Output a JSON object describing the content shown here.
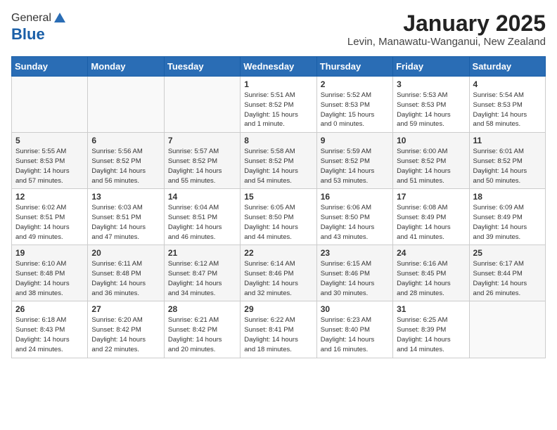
{
  "header": {
    "logo_general": "General",
    "logo_blue": "Blue",
    "month": "January 2025",
    "location": "Levin, Manawatu-Wanganui, New Zealand"
  },
  "weekdays": [
    "Sunday",
    "Monday",
    "Tuesday",
    "Wednesday",
    "Thursday",
    "Friday",
    "Saturday"
  ],
  "weeks": [
    [
      {
        "day": "",
        "info": ""
      },
      {
        "day": "",
        "info": ""
      },
      {
        "day": "",
        "info": ""
      },
      {
        "day": "1",
        "info": "Sunrise: 5:51 AM\nSunset: 8:52 PM\nDaylight: 15 hours\nand 1 minute."
      },
      {
        "day": "2",
        "info": "Sunrise: 5:52 AM\nSunset: 8:53 PM\nDaylight: 15 hours\nand 0 minutes."
      },
      {
        "day": "3",
        "info": "Sunrise: 5:53 AM\nSunset: 8:53 PM\nDaylight: 14 hours\nand 59 minutes."
      },
      {
        "day": "4",
        "info": "Sunrise: 5:54 AM\nSunset: 8:53 PM\nDaylight: 14 hours\nand 58 minutes."
      }
    ],
    [
      {
        "day": "5",
        "info": "Sunrise: 5:55 AM\nSunset: 8:53 PM\nDaylight: 14 hours\nand 57 minutes."
      },
      {
        "day": "6",
        "info": "Sunrise: 5:56 AM\nSunset: 8:52 PM\nDaylight: 14 hours\nand 56 minutes."
      },
      {
        "day": "7",
        "info": "Sunrise: 5:57 AM\nSunset: 8:52 PM\nDaylight: 14 hours\nand 55 minutes."
      },
      {
        "day": "8",
        "info": "Sunrise: 5:58 AM\nSunset: 8:52 PM\nDaylight: 14 hours\nand 54 minutes."
      },
      {
        "day": "9",
        "info": "Sunrise: 5:59 AM\nSunset: 8:52 PM\nDaylight: 14 hours\nand 53 minutes."
      },
      {
        "day": "10",
        "info": "Sunrise: 6:00 AM\nSunset: 8:52 PM\nDaylight: 14 hours\nand 51 minutes."
      },
      {
        "day": "11",
        "info": "Sunrise: 6:01 AM\nSunset: 8:52 PM\nDaylight: 14 hours\nand 50 minutes."
      }
    ],
    [
      {
        "day": "12",
        "info": "Sunrise: 6:02 AM\nSunset: 8:51 PM\nDaylight: 14 hours\nand 49 minutes."
      },
      {
        "day": "13",
        "info": "Sunrise: 6:03 AM\nSunset: 8:51 PM\nDaylight: 14 hours\nand 47 minutes."
      },
      {
        "day": "14",
        "info": "Sunrise: 6:04 AM\nSunset: 8:51 PM\nDaylight: 14 hours\nand 46 minutes."
      },
      {
        "day": "15",
        "info": "Sunrise: 6:05 AM\nSunset: 8:50 PM\nDaylight: 14 hours\nand 44 minutes."
      },
      {
        "day": "16",
        "info": "Sunrise: 6:06 AM\nSunset: 8:50 PM\nDaylight: 14 hours\nand 43 minutes."
      },
      {
        "day": "17",
        "info": "Sunrise: 6:08 AM\nSunset: 8:49 PM\nDaylight: 14 hours\nand 41 minutes."
      },
      {
        "day": "18",
        "info": "Sunrise: 6:09 AM\nSunset: 8:49 PM\nDaylight: 14 hours\nand 39 minutes."
      }
    ],
    [
      {
        "day": "19",
        "info": "Sunrise: 6:10 AM\nSunset: 8:48 PM\nDaylight: 14 hours\nand 38 minutes."
      },
      {
        "day": "20",
        "info": "Sunrise: 6:11 AM\nSunset: 8:48 PM\nDaylight: 14 hours\nand 36 minutes."
      },
      {
        "day": "21",
        "info": "Sunrise: 6:12 AM\nSunset: 8:47 PM\nDaylight: 14 hours\nand 34 minutes."
      },
      {
        "day": "22",
        "info": "Sunrise: 6:14 AM\nSunset: 8:46 PM\nDaylight: 14 hours\nand 32 minutes."
      },
      {
        "day": "23",
        "info": "Sunrise: 6:15 AM\nSunset: 8:46 PM\nDaylight: 14 hours\nand 30 minutes."
      },
      {
        "day": "24",
        "info": "Sunrise: 6:16 AM\nSunset: 8:45 PM\nDaylight: 14 hours\nand 28 minutes."
      },
      {
        "day": "25",
        "info": "Sunrise: 6:17 AM\nSunset: 8:44 PM\nDaylight: 14 hours\nand 26 minutes."
      }
    ],
    [
      {
        "day": "26",
        "info": "Sunrise: 6:18 AM\nSunset: 8:43 PM\nDaylight: 14 hours\nand 24 minutes."
      },
      {
        "day": "27",
        "info": "Sunrise: 6:20 AM\nSunset: 8:42 PM\nDaylight: 14 hours\nand 22 minutes."
      },
      {
        "day": "28",
        "info": "Sunrise: 6:21 AM\nSunset: 8:42 PM\nDaylight: 14 hours\nand 20 minutes."
      },
      {
        "day": "29",
        "info": "Sunrise: 6:22 AM\nSunset: 8:41 PM\nDaylight: 14 hours\nand 18 minutes."
      },
      {
        "day": "30",
        "info": "Sunrise: 6:23 AM\nSunset: 8:40 PM\nDaylight: 14 hours\nand 16 minutes."
      },
      {
        "day": "31",
        "info": "Sunrise: 6:25 AM\nSunset: 8:39 PM\nDaylight: 14 hours\nand 14 minutes."
      },
      {
        "day": "",
        "info": ""
      }
    ]
  ]
}
